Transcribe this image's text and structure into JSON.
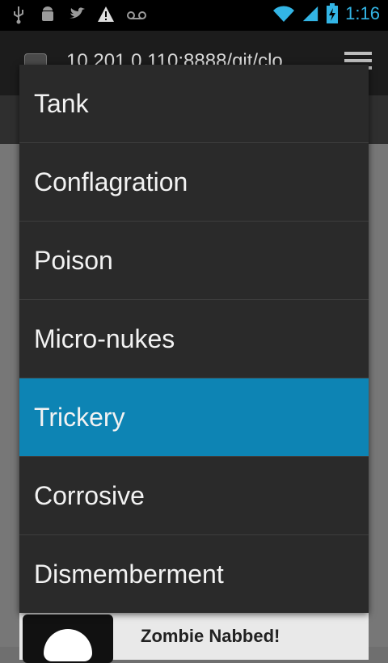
{
  "status_bar": {
    "time": "1:16",
    "icons": [
      "usb-icon",
      "android-debug-icon",
      "twitter-icon",
      "warning-icon",
      "voicemail-icon",
      "wifi-icon",
      "signal-icon",
      "battery-charging-icon"
    ]
  },
  "browser": {
    "url": "10.201.0.110:8888/git/clo"
  },
  "menu": {
    "items": [
      {
        "label": "Tank"
      },
      {
        "label": "Conflagration"
      },
      {
        "label": "Poison"
      },
      {
        "label": "Micro-nukes"
      },
      {
        "label": "Trickery",
        "selected": true
      },
      {
        "label": "Corrosive"
      },
      {
        "label": "Dismemberment"
      }
    ]
  },
  "card": {
    "title": "Zombie Nabbed!"
  },
  "colors": {
    "accent": "#33b5e5",
    "selected": "#0d84b4",
    "menu_bg": "#2a2a2a"
  }
}
